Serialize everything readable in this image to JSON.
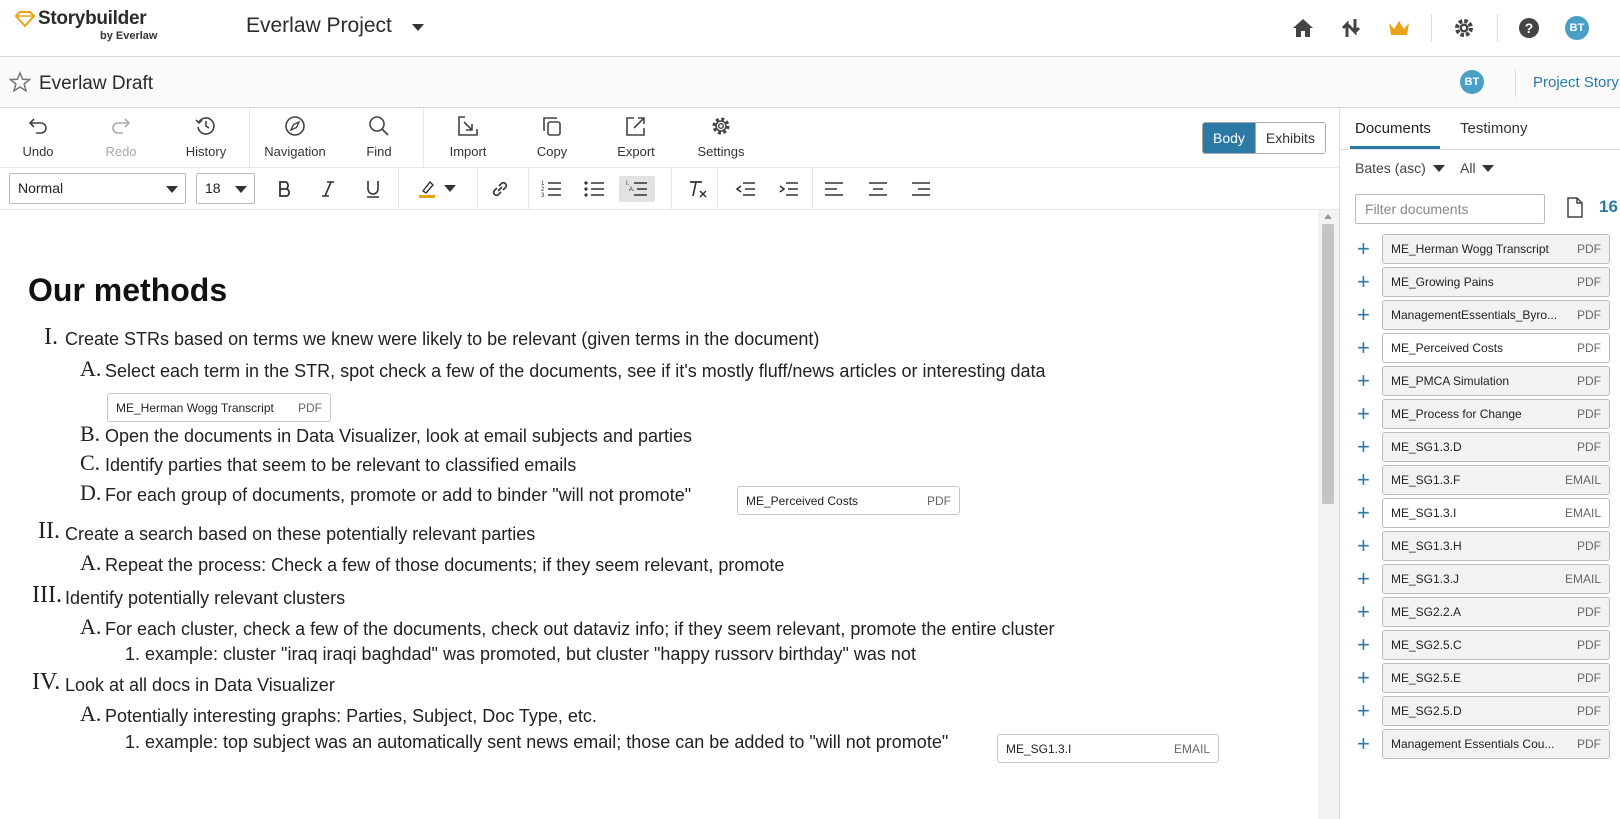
{
  "header": {
    "logo_main": "Storybuilder",
    "logo_sub": "by Everlaw",
    "project_name": "Everlaw Project",
    "avatar_initials": "BT"
  },
  "subheader": {
    "draft_title": "Everlaw Draft",
    "avatar_initials": "BT",
    "project_story_link": "Project Story"
  },
  "toolbar": {
    "undo": "Undo",
    "redo": "Redo",
    "history": "History",
    "navigation": "Navigation",
    "find": "Find",
    "import": "Import",
    "copy": "Copy",
    "export": "Export",
    "settings": "Settings",
    "view_body": "Body",
    "view_exhibits": "Exhibits",
    "style_select": "Normal",
    "size_select": "18"
  },
  "document": {
    "heading": "Our methods",
    "lines": [
      {
        "marker": "I.",
        "text": "Create STRs based on terms we knew were likely to be relevant (given terms in the document)"
      },
      {
        "marker": "A.",
        "text": "Select each term in the STR, spot check a few of the documents, see if it's mostly fluff/news articles or interesting data"
      },
      {
        "marker": "B.",
        "text": "Open the documents in Data Visualizer, look at email subjects and parties"
      },
      {
        "marker": "C.",
        "text": "Identify parties that seem to be relevant to classified emails"
      },
      {
        "marker": "D.",
        "text": "For each group of documents, promote or add to binder \"will not promote\""
      },
      {
        "marker": "II.",
        "text": "Create a search based on these potentially relevant parties"
      },
      {
        "marker": "A.",
        "text": "Repeat the process: Check a few of those documents; if they seem relevant, promote"
      },
      {
        "marker": "III.",
        "text": "Identify potentially relevant clusters"
      },
      {
        "marker": "A.",
        "text": "For each cluster, check a few of the documents, check out dataviz info; if they seem relevant, promote the entire cluster"
      },
      {
        "marker": "1.",
        "text": "example: cluster \"iraq iraqi baghdad\" was promoted, but cluster \"happy russorv birthday\" was not"
      },
      {
        "marker": "IV.",
        "text": "Look at all docs in Data Visualizer"
      },
      {
        "marker": "A.",
        "text": "Potentially interesting graphs: Parties, Subject, Doc Type, etc."
      },
      {
        "marker": "1.",
        "text": "example: top subject was an automatically sent news email; those can be added to \"will not promote\""
      }
    ],
    "chips": [
      {
        "name": "ME_Herman Wogg Transcript",
        "type": "PDF"
      },
      {
        "name": "ME_Perceived Costs",
        "type": "PDF"
      },
      {
        "name": "ME_SG1.3.I",
        "type": "EMAIL"
      }
    ]
  },
  "sidebar": {
    "tab_documents": "Documents",
    "tab_testimony": "Testimony",
    "sort_label": "Bates (asc)",
    "filter_label": "All",
    "filter_placeholder": "Filter documents",
    "count": "16",
    "documents": [
      {
        "name": "ME_Herman Wogg Transcript",
        "type": "PDF"
      },
      {
        "name": "ME_Growing Pains",
        "type": "PDF"
      },
      {
        "name": "ManagementEssentials_Byro...",
        "type": "PDF"
      },
      {
        "name": "ME_Perceived Costs",
        "type": "PDF"
      },
      {
        "name": "ME_PMCA Simulation",
        "type": "PDF"
      },
      {
        "name": "ME_Process for Change",
        "type": "PDF"
      },
      {
        "name": "ME_SG1.3.D",
        "type": "PDF"
      },
      {
        "name": "ME_SG1.3.F",
        "type": "EMAIL"
      },
      {
        "name": "ME_SG1.3.I",
        "type": "EMAIL"
      },
      {
        "name": "ME_SG1.3.H",
        "type": "PDF"
      },
      {
        "name": "ME_SG1.3.J",
        "type": "EMAIL"
      },
      {
        "name": "ME_SG2.2.A",
        "type": "PDF"
      },
      {
        "name": "ME_SG2.5.C",
        "type": "PDF"
      },
      {
        "name": "ME_SG2.5.E",
        "type": "PDF"
      },
      {
        "name": "ME_SG2.5.D",
        "type": "PDF"
      },
      {
        "name": "Management Essentials Cou...",
        "type": "PDF"
      }
    ]
  },
  "colors": {
    "accent": "#2a7aa5",
    "crown": "#e8a317",
    "avatar": "#4a9fc6"
  }
}
